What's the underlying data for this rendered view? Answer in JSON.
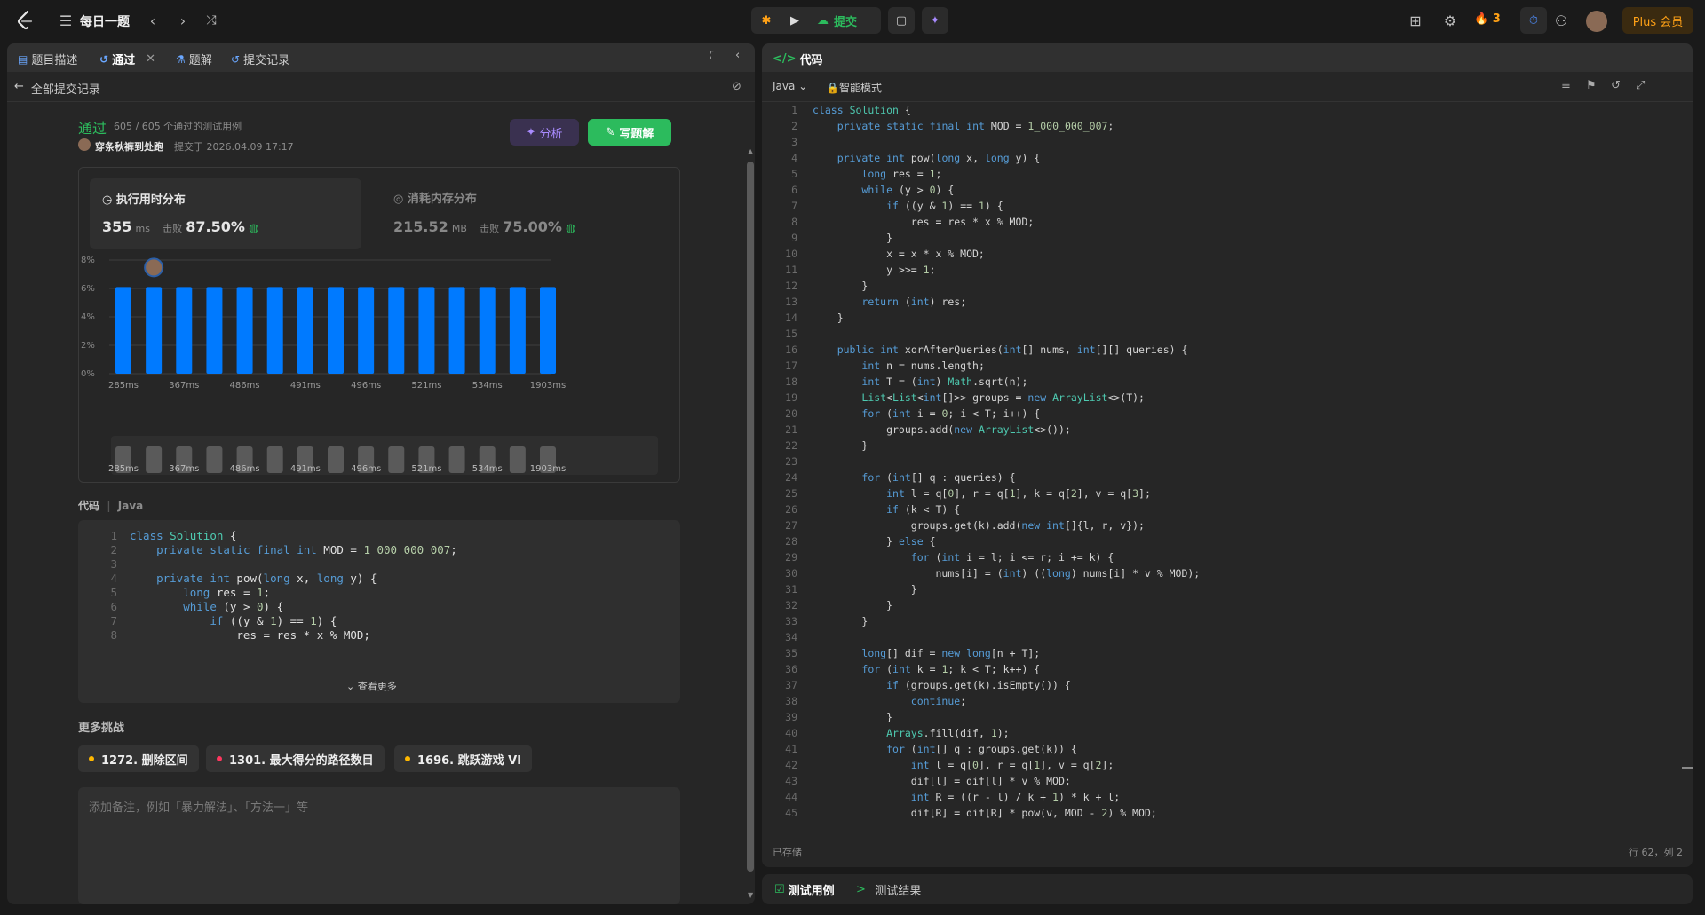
{
  "colors": {
    "bg": "#1a1a1a",
    "panel": "#262626",
    "accent_green": "#2cbb5d",
    "bar_blue": "#007aff",
    "plus_orange": "#ffa116"
  },
  "topbar": {
    "title": "每日一题",
    "submit_label": "提交",
    "streak": "3",
    "plus_label": "Plus 会员"
  },
  "left": {
    "tabs": [
      "题目描述",
      "通过",
      "题解",
      "提交记录"
    ],
    "back_label": "全部提交记录",
    "status": "通过",
    "tests": "605 / 605 个通过的测试用例",
    "user": "穿条秋裤到处跑",
    "submitted_at": "提交于 2026.04.09 17:17",
    "analyze_label": "分析",
    "write_label": "写题解",
    "runtime": {
      "title": "执行用时分布",
      "value": "355",
      "unit": "ms",
      "beat_label": "击败",
      "beat": "87.50%"
    },
    "memory": {
      "title": "消耗内存分布",
      "value": "215.52",
      "unit": "MB",
      "beat_label": "击败",
      "beat": "75.00%"
    },
    "code_header": "代码",
    "code_lang": "Java",
    "code_lines": [
      "class Solution {",
      "    private static final int MOD = 1_000_000_007;",
      "",
      "    private int pow(long x, long y) {",
      "        long res = 1;",
      "        while (y > 0) {",
      "            if ((y & 1) == 1) {",
      "                res = res * x % MOD;"
    ],
    "see_more": "查看更多",
    "more_challenges": "更多挑战",
    "challenges": [
      {
        "label": "1272. 删除区间",
        "color": "#ffb800"
      },
      {
        "label": "1301. 最大得分的路径数目",
        "color": "#ff375f"
      },
      {
        "label": "1696. 跳跃游戏 VI",
        "color": "#ffb800"
      }
    ],
    "note_placeholder": "添加备注，例如「暴力解法」、「方法一」等"
  },
  "chart_data": {
    "type": "bar",
    "title": "",
    "ylabel": "",
    "yticks": [
      "8%",
      "6%",
      "4%",
      "2%",
      "0%"
    ],
    "ylim": [
      0,
      8
    ],
    "values": [
      6.1,
      6.1,
      6.1,
      6.1,
      6.1,
      6.1,
      6.1,
      6.1,
      6.1,
      6.1,
      6.1,
      6.1,
      6.1,
      6.1,
      6.1
    ],
    "xtick_labels": [
      "285ms",
      "367ms",
      "486ms",
      "491ms",
      "496ms",
      "521ms",
      "534ms",
      "1903ms"
    ],
    "highlight_index": 1
  },
  "right": {
    "tab_label": "代码",
    "lang": "Java",
    "mode": "智能模式",
    "saved": "已存储",
    "cursor": "行 62，列 2",
    "lines": [
      "class Solution {",
      "    private static final int MOD = 1_000_000_007;",
      "",
      "    private int pow(long x, long y) {",
      "        long res = 1;",
      "        while (y > 0) {",
      "            if ((y & 1) == 1) {",
      "                res = res * x % MOD;",
      "            }",
      "            x = x * x % MOD;",
      "            y >>= 1;",
      "        }",
      "        return (int) res;",
      "    }",
      "",
      "    public int xorAfterQueries(int[] nums, int[][] queries) {",
      "        int n = nums.length;",
      "        int T = (int) Math.sqrt(n);",
      "        List<List<int[]>> groups = new ArrayList<>(T);",
      "        for (int i = 0; i < T; i++) {",
      "            groups.add(new ArrayList<>());",
      "        }",
      "",
      "        for (int[] q : queries) {",
      "            int l = q[0], r = q[1], k = q[2], v = q[3];",
      "            if (k < T) {",
      "                groups.get(k).add(new int[]{l, r, v});",
      "            } else {",
      "                for (int i = l; i <= r; i += k) {",
      "                    nums[i] = (int) ((long) nums[i] * v % MOD);",
      "                }",
      "            }",
      "        }",
      "",
      "        long[] dif = new long[n + T];",
      "        for (int k = 1; k < T; k++) {",
      "            if (groups.get(k).isEmpty()) {",
      "                continue;",
      "            }",
      "            Arrays.fill(dif, 1);",
      "            for (int[] q : groups.get(k)) {",
      "                int l = q[0], r = q[1], v = q[2];",
      "                dif[l] = dif[l] * v % MOD;",
      "                int R = ((r - l) / k + 1) * k + l;",
      "                dif[R] = dif[R] * pow(v, MOD - 2) % MOD;"
    ]
  },
  "bottom": {
    "tab1": "测试用例",
    "tab2": "测试结果"
  }
}
